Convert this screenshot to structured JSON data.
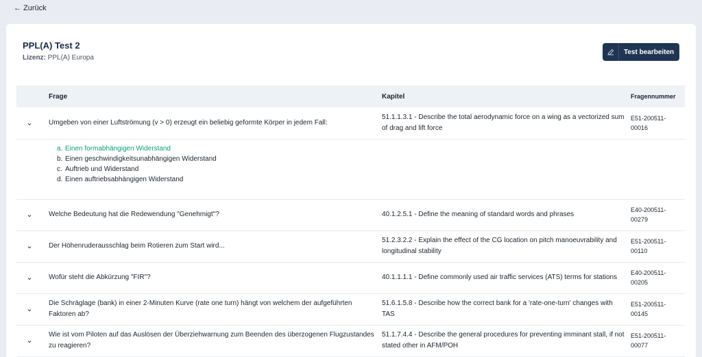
{
  "nav": {
    "back_label": "Zurück"
  },
  "header": {
    "title": "PPL(A) Test 2",
    "license_label": "Lizenz:",
    "license_value": "PPL(A) Europa",
    "edit_button": "Test bearbeiten"
  },
  "table": {
    "headers": {
      "question": "Frage",
      "chapter": "Kapitel",
      "number": "Fragennummer"
    },
    "rows": [
      {
        "question": "Umgeben von einer Luftströmung (v > 0) erzeugt ein beliebig geformte Körper in jedem Fall:",
        "chapter": "51.1.1.3.1 - Describe the total aerodynamic force on a wing as a vectorized sum of drag and lift force",
        "number": "E51-200511-00016",
        "answers": [
          {
            "marker": "a.",
            "text": "Einen formabhängigen Widerstand"
          },
          {
            "marker": "b.",
            "text": "Einen geschwindigkeitsunabhängigen Widerstand"
          },
          {
            "marker": "c.",
            "text": "Auftrieb und Widerstand"
          },
          {
            "marker": "d.",
            "text": "Einen auftriebsabhängigen Widerstand"
          }
        ]
      },
      {
        "question": "Welche Bedeutung hat die Redewendung \"Genehmigt\"?",
        "chapter": "40.1.2.5.1 - Define the meaning of standard words and phrases",
        "number": "E40-200511-00279"
      },
      {
        "question": "Der Höhenruderausschlag beim Rotieren zum Start wird...",
        "chapter": "51.2.3.2.2 - Explain the effect of the CG location on pitch manoeuvrability and longitudinal stability",
        "number": "E51-200511-00110"
      },
      {
        "question": "Wofür steht die Abkürzung \"FIR\"?",
        "chapter": "40.1.1.1.1 - Define commonly used air traffic services (ATS) terms for stations",
        "number": "E40-200511-00205"
      },
      {
        "question": "Die Schräglage (bank) in einer 2-Minuten Kurve (rate one turn) hängt von welchem der aufgeführten Faktoren ab?",
        "chapter": "51.6.1.5.8 - Describe how the correct bank for a 'rate-one-turn' changes with TAS",
        "number": "E51-200511-00145"
      },
      {
        "question": "Wie ist vom Piloten auf das Auslösen der Überziehwarnung zum Beenden des überzogenen Flugzustandes zu reagieren?",
        "chapter": "51.1.7.4.4 - Describe the general procedures for preventing imminant stall, if not stated other in AFM/POH",
        "number": "E51-200511-00077"
      }
    ]
  }
}
